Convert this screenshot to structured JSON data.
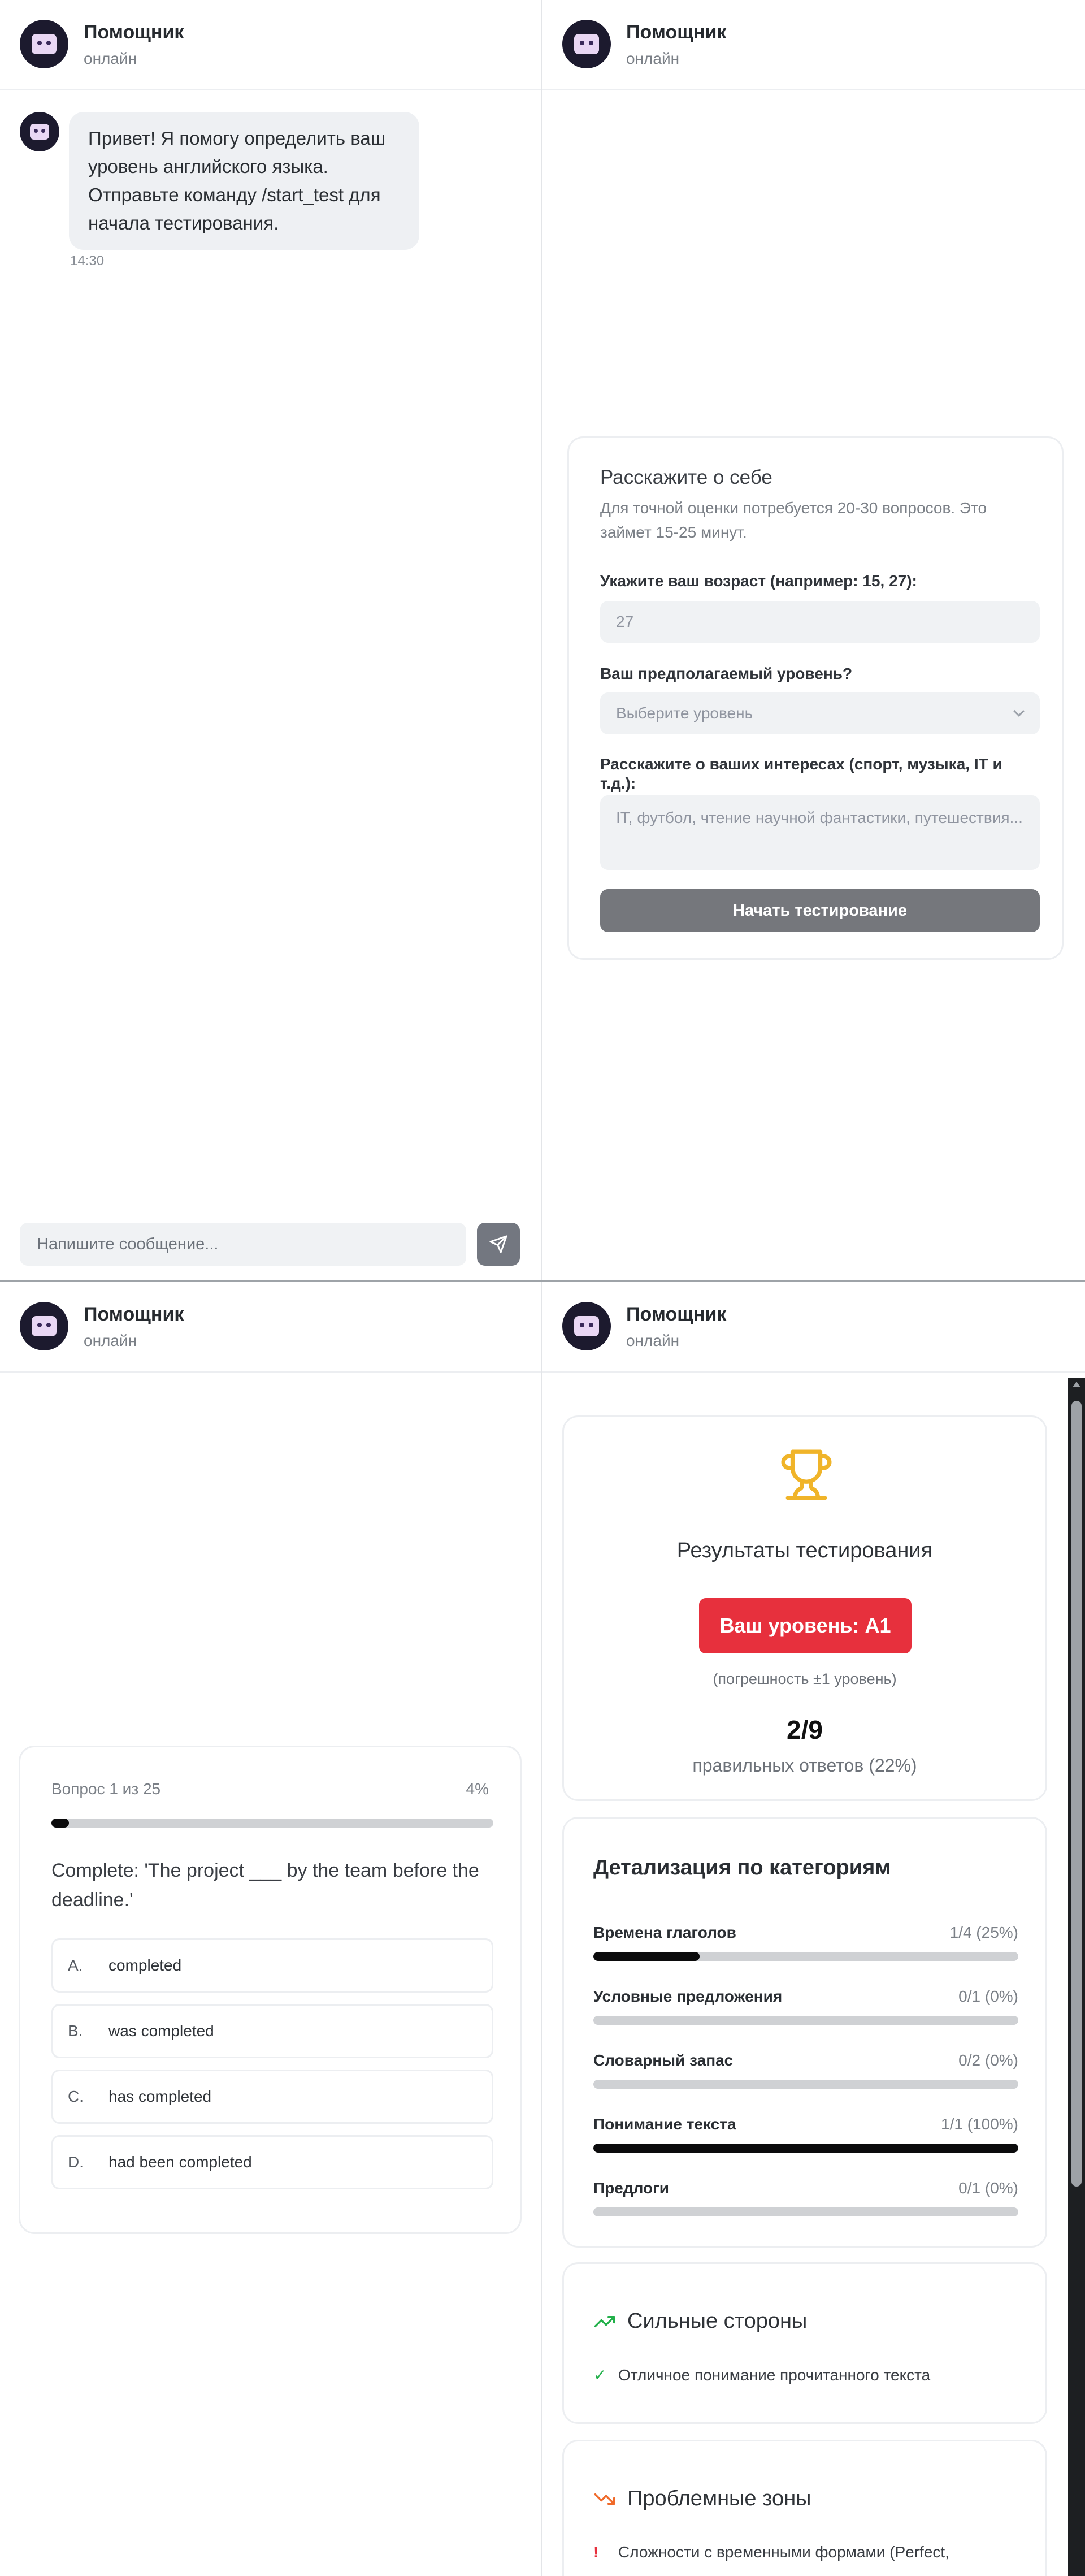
{
  "header": {
    "title": "Помощник",
    "status": "онлайн"
  },
  "chat": {
    "message": "Привет! Я помогу определить ваш уровень английского языка. Отправьте команду /start_test для начала тестирования.",
    "time": "14:30",
    "composer_placeholder": "Напишите сообщение..."
  },
  "form": {
    "title": "Расскажите о себе",
    "description": "Для точной оценки потребуется 20-30 вопросов. Это займет 15-25 минут.",
    "age_label": "Укажите ваш возраст (например: 15, 27):",
    "age_value": "27",
    "level_label": "Ваш предполагаемый уровень?",
    "level_placeholder": "Выберите уровень",
    "interests_label": "Расскажите о ваших интересах (спорт, музыка, IT и т.д.):",
    "interests_placeholder": "IT, футбол, чтение научной фантастики, путешествия...",
    "start_button": "Начать тестирование"
  },
  "quiz": {
    "counter": "Вопрос 1 из 25",
    "percent": "4%",
    "progress": 0.04,
    "question": "Complete: 'The project ___ by the team before the deadline.'",
    "options": [
      {
        "letter": "A.",
        "text": "completed"
      },
      {
        "letter": "B.",
        "text": "was completed"
      },
      {
        "letter": "C.",
        "text": "has completed"
      },
      {
        "letter": "D.",
        "text": "had been completed"
      }
    ]
  },
  "results": {
    "title": "Результаты тестирования",
    "level": "Ваш уровень: A1",
    "margin_note": "(погрешность ±1 уровень)",
    "score": "2/9",
    "correct_text": "правильных ответов (22%)",
    "colors": {
      "accent_red": "#e7303d",
      "trophy": "#f0b429",
      "strength": "#22b04a",
      "problem": "#f06a2a"
    },
    "details_title": "Детализация по категориям",
    "categories": [
      {
        "name": "Времена глаголов",
        "value": "1/4 (25%)",
        "fraction": 0.25
      },
      {
        "name": "Условные предложения",
        "value": "0/1 (0%)",
        "fraction": 0
      },
      {
        "name": "Словарный запас",
        "value": "0/2 (0%)",
        "fraction": 0
      },
      {
        "name": "Понимание текста",
        "value": "1/1 (100%)",
        "fraction": 1
      },
      {
        "name": "Предлоги",
        "value": "0/1 (0%)",
        "fraction": 0
      }
    ],
    "strengths_title": "Сильные стороны",
    "strength_item": "Отличное понимание прочитанного текста",
    "problems_title": "Проблемные зоны",
    "problem_item": "Сложности с временными формами (Perfect,"
  }
}
